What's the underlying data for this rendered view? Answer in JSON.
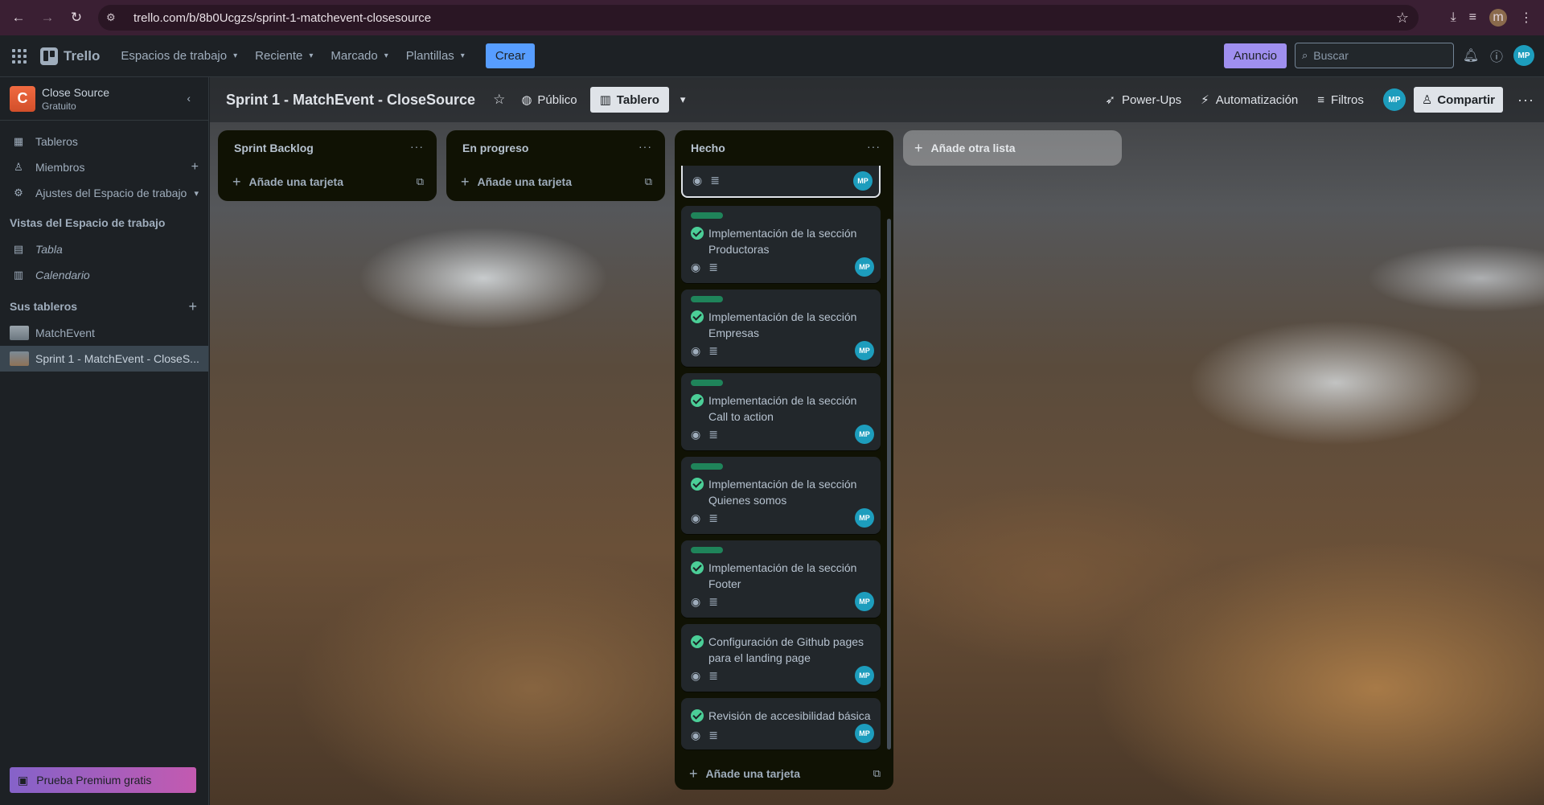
{
  "browser": {
    "url": "trello.com/b/8b0Ucgzs/sprint-1-matchevent-closesource",
    "profile_initial": "m"
  },
  "header": {
    "app_name": "Trello",
    "menu": [
      {
        "label": "Espacios de trabajo"
      },
      {
        "label": "Reciente"
      },
      {
        "label": "Marcado"
      },
      {
        "label": "Plantillas"
      }
    ],
    "create_label": "Crear",
    "promo_label": "Anuncio",
    "search_placeholder": "Buscar",
    "avatar_initials": "MP"
  },
  "sidebar": {
    "workspace_initial": "C",
    "workspace_name": "Close Source",
    "workspace_plan": "Gratuito",
    "items": [
      {
        "label": "Tableros"
      },
      {
        "label": "Miembros"
      },
      {
        "label": "Ajustes del Espacio de trabajo"
      }
    ],
    "views_title": "Vistas del Espacio de trabajo",
    "views": [
      {
        "label": "Tabla"
      },
      {
        "label": "Calendario"
      }
    ],
    "boards_title": "Sus tableros",
    "boards": [
      {
        "label": "MatchEvent"
      },
      {
        "label": "Sprint 1 - MatchEvent - CloseS..."
      }
    ],
    "premium_label": "Prueba Premium gratis"
  },
  "board": {
    "title": "Sprint 1 - MatchEvent - CloseSource",
    "visibility": "Público",
    "view_label": "Tablero",
    "actions": [
      {
        "label": "Power-Ups"
      },
      {
        "label": "Automatización"
      },
      {
        "label": "Filtros"
      }
    ],
    "share_label": "Compartir",
    "member_initials": "MP",
    "add_list_label": "Añade otra lista"
  },
  "lists": [
    {
      "title": "Sprint Backlog",
      "add_card_label": "Añade una tarjeta"
    },
    {
      "title": "En progreso",
      "add_card_label": "Añade una tarjeta"
    },
    {
      "title": "Hecho",
      "add_card_label": "Añade una tarjeta"
    }
  ],
  "done_cards": [
    {
      "title": "Implementación de la sección Productoras",
      "member": "MP"
    },
    {
      "title": "Implementación de la sección Empresas",
      "member": "MP"
    },
    {
      "title": "Implementación de la sección Call to action",
      "member": "MP"
    },
    {
      "title": "Implementación de la sección Quienes somos",
      "member": "MP"
    },
    {
      "title": "Implementación de la sección Footer",
      "member": "MP"
    },
    {
      "title": "Configuración de Github pages para el landing page",
      "member": "MP"
    },
    {
      "title": "Revisión de accesibilidad básica",
      "member": "MP"
    }
  ],
  "first_card_member": "MP",
  "colors": {
    "label_green": "#1f845a",
    "check_green": "#4bce97",
    "accent_blue": "#579dff",
    "promo_purple": "#9f8fef"
  }
}
